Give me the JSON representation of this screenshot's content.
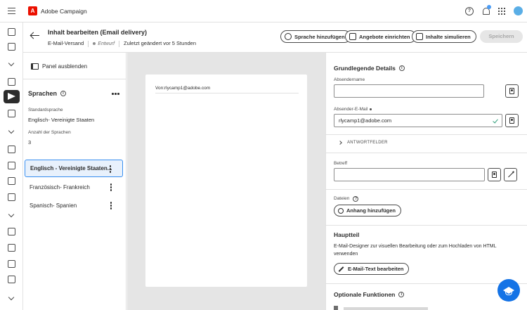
{
  "app": {
    "title": "Adobe Campaign",
    "logo_glyph": "A"
  },
  "topbar": {
    "icons": [
      "menu-icon",
      "help-icon",
      "bell-icon",
      "apps-grid-icon",
      "avatar"
    ],
    "help_glyph": "?",
    "accent": "#4b9cf5"
  },
  "rail": {
    "icons": [
      "home-icon",
      "search-icon",
      "chevron-down-icon",
      "megaphone-icon",
      "send-icon",
      "workflow-icon",
      "chevron-down-icon",
      "list-icon",
      "template-icon",
      "chart-icon",
      "shield-icon",
      "chevron-down-icon",
      "user-icon",
      "users-icon",
      "inbox-icon",
      "rule-icon",
      "chevron-down-icon"
    ]
  },
  "header": {
    "title": "Inhalt bearbeiten (Email delivery)",
    "channel": "E-Mail-Versand",
    "status": "Entwurf",
    "modified": "Zuletzt geändert vor 5 Stunden",
    "buttons": {
      "add_language": "Sprache hinzufügen",
      "offers": "Angebote einrichten",
      "simulate": "Inhalte simulieren",
      "save": "Speichern"
    }
  },
  "left_panel": {
    "hide_panel": "Panel ausblenden",
    "languages_title": "Sprachen",
    "default_language_label": "Standardsprache",
    "default_language_value": "Englisch- Vereinigte Staaten",
    "language_count_label": "Anzahl der Sprachen",
    "language_count_value": "3",
    "languages": [
      {
        "label": "Englisch - Vereinigte Staaten...",
        "selected": true
      },
      {
        "label": "Französisch- Frankreich",
        "selected": false
      },
      {
        "label": "Spanisch- Spanien",
        "selected": false
      }
    ]
  },
  "preview": {
    "from": "Von:rlycamp1@adobe.com"
  },
  "right_panel": {
    "basic_details_title": "Grundlegende Details",
    "sender_name_label": "Absendername",
    "sender_name_value": "",
    "sender_email_label": "Absender-E-Mail",
    "sender_email_value": "rlycamp1@adobe.com",
    "reply_fields": "ANTWORTFELDER",
    "subject_label": "Betreff",
    "subject_value": "",
    "files_label": "Dateien",
    "add_attachment": "Anhang hinzufügen",
    "main_title": "Hauptteil",
    "main_text": "E-Mail-Designer zur visuellen Bearbeitung oder zum Hochladen von HTML verwenden",
    "edit_email_text": "E-Mail-Text bearbeiten",
    "optional_title": "Optionale Funktionen"
  },
  "colors": {
    "brand": "#eb1000",
    "selection": "#378ef0",
    "valid": "#2d9d78",
    "fab": "#1473e6"
  }
}
